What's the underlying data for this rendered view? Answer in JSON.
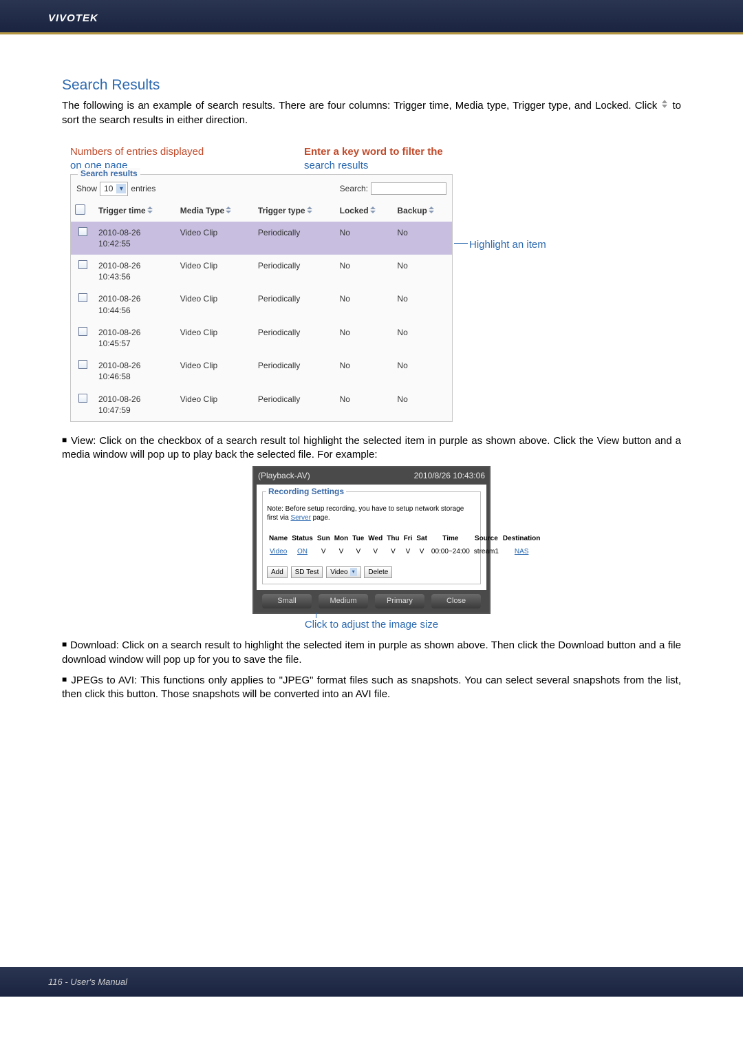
{
  "brand": "VIVOTEK",
  "section_title": "Search Results",
  "section_desc_1": "The following is an example of search results. There are four columns: Trigger time, Media type, Trigger type, and Locked. Click ",
  "section_desc_2": " to sort the search results in either direction.",
  "annot": {
    "left_l1": "Numbers of entries displayed",
    "left_l2": "on one page",
    "right_l1": "Enter a key word to filter the",
    "right_l2": "search results",
    "highlight": "Highlight an item"
  },
  "results": {
    "legend": "Search results",
    "show_label": "Show",
    "entries_value": "10",
    "entries_label": "entries",
    "search_label": "Search:",
    "search_value": "",
    "columns": {
      "trigger_time": "Trigger time",
      "media_type": "Media Type",
      "trigger_type": "Trigger type",
      "locked": "Locked",
      "backup": "Backup"
    },
    "rows": [
      {
        "t": "2010-08-26 10:42:55",
        "m": "Video Clip",
        "ty": "Periodically",
        "l": "No",
        "b": "No",
        "hl": true
      },
      {
        "t": "2010-08-26 10:43:56",
        "m": "Video Clip",
        "ty": "Periodically",
        "l": "No",
        "b": "No",
        "hl": false
      },
      {
        "t": "2010-08-26 10:44:56",
        "m": "Video Clip",
        "ty": "Periodically",
        "l": "No",
        "b": "No",
        "hl": false
      },
      {
        "t": "2010-08-26 10:45:57",
        "m": "Video Clip",
        "ty": "Periodically",
        "l": "No",
        "b": "No",
        "hl": false
      },
      {
        "t": "2010-08-26 10:46:58",
        "m": "Video Clip",
        "ty": "Periodically",
        "l": "No",
        "b": "No",
        "hl": false
      },
      {
        "t": "2010-08-26 10:47:59",
        "m": "Video Clip",
        "ty": "Periodically",
        "l": "No",
        "b": "No",
        "hl": false
      }
    ]
  },
  "bullets": {
    "view": "View: Click on the checkbox of a search result tol highlight the selected item in purple as shown above. Click the View button and a media window will pop up to play back the selected file. For example:",
    "download": "Download: Click on a search result to highlight the selected item in purple as shown above. Then click the Download button and a file download window will pop up for you to save the file.",
    "jpegs": "JPEGs to AVI: This functions only applies to \"JPEG\" format files such as snapshots. You can select several snapshots from the list, then click this button. Those snapshots will be converted into an AVI file."
  },
  "shot2": {
    "title_left": "(Playback-AV)",
    "title_right": "2010/8/26 10:43:06",
    "legend": "Recording Settings",
    "note_1": "Note: Before setup recording, you have to setup network storage first via ",
    "note_link": "Server",
    "note_2": " page.",
    "cols": [
      "Name",
      "Status",
      "Sun",
      "Mon",
      "Tue",
      "Wed",
      "Thu",
      "Fri",
      "Sat",
      "Time",
      "Source",
      "Destination"
    ],
    "row": {
      "name": "Video",
      "status": "ON",
      "sun": "V",
      "mon": "V",
      "tue": "V",
      "wed": "V",
      "thu": "V",
      "fri": "V",
      "sat": "V",
      "time": "00:00~24:00",
      "source": "stream1",
      "dest": "NAS"
    },
    "btns": {
      "add": "Add",
      "sdtest": "SD Test",
      "video": "Video",
      "delete": "Delete"
    },
    "pills": {
      "small": "Small",
      "medium": "Medium",
      "primary": "Primary",
      "close": "Close"
    },
    "annot": "Click to adjust the image size"
  },
  "footer": "116 - User's Manual"
}
